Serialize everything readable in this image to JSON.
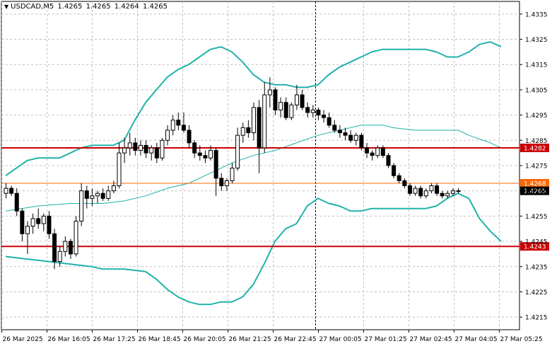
{
  "header": {
    "symbol": "USDCAD,M5",
    "open": "1.4265",
    "high": "1.4265",
    "low": "1.4264",
    "close": "1.4265"
  },
  "colors": {
    "candle": "#000000",
    "band": "#20b2aa",
    "grid": "#c0c0c0",
    "support_resistance": "#cc0000",
    "level_mid": "#ff6600",
    "current_price_bg": "#000000"
  },
  "chart_data": {
    "type": "candlestick",
    "symbol": "USDCAD",
    "timeframe": "M5",
    "ylim": [
      1.421,
      1.434
    ],
    "y_ticks": [
      "1.4335",
      "1.4325",
      "1.4315",
      "1.4305",
      "1.4295",
      "1.4285",
      "1.4275",
      "1.4265",
      "1.4255",
      "1.4245",
      "1.4235",
      "1.4225",
      "1.4215"
    ],
    "x_ticks": [
      "26 Mar 2025",
      "26 Mar 16:05",
      "26 Mar 17:25",
      "26 Mar 18:45",
      "26 Mar 20:05",
      "26 Mar 21:25",
      "26 Mar 22:45",
      "27 Mar 00:05",
      "27 Mar 01:25",
      "27 Mar 02:45",
      "27 Mar 04:05",
      "27 Mar 05:25"
    ],
    "grid": true,
    "separator_label": "27 Mar 00:05",
    "levels": [
      {
        "price": 1.4282,
        "label": "1.4282",
        "color": "#cc0000",
        "width": 2
      },
      {
        "price": 1.4268,
        "label": "1.4268",
        "color": "#ff6600",
        "width": 1
      },
      {
        "price": 1.4243,
        "label": "1.4243",
        "color": "#cc0000",
        "width": 2
      }
    ],
    "current_price": {
      "price": 1.4265,
      "label": "1.4265"
    },
    "bollinger_upper": [
      [
        0,
        1.4271
      ],
      [
        2,
        1.4274
      ],
      [
        4,
        1.4277
      ],
      [
        6,
        1.4278
      ],
      [
        8,
        1.4278
      ],
      [
        10,
        1.4278
      ],
      [
        12,
        1.428
      ],
      [
        14,
        1.4282
      ],
      [
        16,
        1.4283
      ],
      [
        18,
        1.4283
      ],
      [
        20,
        1.4283
      ],
      [
        22,
        1.4285
      ],
      [
        24,
        1.4293
      ],
      [
        26,
        1.43
      ],
      [
        28,
        1.4305
      ],
      [
        30,
        1.431
      ],
      [
        32,
        1.4313
      ],
      [
        34,
        1.4315
      ],
      [
        36,
        1.4318
      ],
      [
        38,
        1.4321
      ],
      [
        40,
        1.4322
      ],
      [
        42,
        1.432
      ],
      [
        44,
        1.4316
      ],
      [
        46,
        1.4311
      ],
      [
        48,
        1.4308
      ],
      [
        50,
        1.4307
      ],
      [
        52,
        1.4307
      ],
      [
        54,
        1.4306
      ],
      [
        56,
        1.4306
      ],
      [
        58,
        1.4307
      ],
      [
        60,
        1.4311
      ],
      [
        62,
        1.4314
      ],
      [
        64,
        1.4316
      ],
      [
        66,
        1.4318
      ],
      [
        68,
        1.432
      ],
      [
        70,
        1.4321
      ],
      [
        72,
        1.4321
      ],
      [
        74,
        1.4321
      ],
      [
        76,
        1.4321
      ],
      [
        78,
        1.4321
      ],
      [
        80,
        1.432
      ],
      [
        82,
        1.4318
      ],
      [
        84,
        1.4318
      ],
      [
        86,
        1.432
      ],
      [
        88,
        1.4323
      ],
      [
        90,
        1.4324
      ],
      [
        92,
        1.4322
      ]
    ],
    "bollinger_middle": [
      [
        0,
        1.4257
      ],
      [
        6,
        1.4259
      ],
      [
        12,
        1.426
      ],
      [
        18,
        1.426
      ],
      [
        22,
        1.4261
      ],
      [
        26,
        1.4263
      ],
      [
        30,
        1.4266
      ],
      [
        34,
        1.4268
      ],
      [
        38,
        1.4272
      ],
      [
        42,
        1.4276
      ],
      [
        46,
        1.4279
      ],
      [
        50,
        1.4281
      ],
      [
        54,
        1.4284
      ],
      [
        58,
        1.4287
      ],
      [
        62,
        1.4289
      ],
      [
        66,
        1.4291
      ],
      [
        70,
        1.4291
      ],
      [
        72,
        1.429
      ],
      [
        76,
        1.4289
      ],
      [
        80,
        1.4289
      ],
      [
        84,
        1.4289
      ],
      [
        86,
        1.4287
      ],
      [
        90,
        1.4284
      ],
      [
        92,
        1.4282
      ]
    ],
    "bollinger_lower": [
      [
        0,
        1.4239
      ],
      [
        4,
        1.4238
      ],
      [
        8,
        1.4237
      ],
      [
        12,
        1.4236
      ],
      [
        16,
        1.4235
      ],
      [
        18,
        1.4234
      ],
      [
        22,
        1.4234
      ],
      [
        26,
        1.4233
      ],
      [
        28,
        1.423
      ],
      [
        30,
        1.4226
      ],
      [
        32,
        1.4223
      ],
      [
        34,
        1.4221
      ],
      [
        36,
        1.422
      ],
      [
        38,
        1.422
      ],
      [
        40,
        1.4221
      ],
      [
        42,
        1.4221
      ],
      [
        44,
        1.4223
      ],
      [
        46,
        1.4228
      ],
      [
        48,
        1.4236
      ],
      [
        50,
        1.4245
      ],
      [
        52,
        1.425
      ],
      [
        54,
        1.4252
      ],
      [
        56,
        1.4259
      ],
      [
        58,
        1.4262
      ],
      [
        60,
        1.426
      ],
      [
        62,
        1.4259
      ],
      [
        64,
        1.4257
      ],
      [
        66,
        1.4257
      ],
      [
        68,
        1.4258
      ],
      [
        70,
        1.4258
      ],
      [
        72,
        1.4258
      ],
      [
        74,
        1.4258
      ],
      [
        76,
        1.4258
      ],
      [
        78,
        1.4258
      ],
      [
        80,
        1.4259
      ],
      [
        82,
        1.4262
      ],
      [
        84,
        1.4264
      ],
      [
        86,
        1.4262
      ],
      [
        88,
        1.4254
      ],
      [
        90,
        1.4249
      ],
      [
        92,
        1.4245
      ]
    ],
    "candles": [
      {
        "o": 1.4264,
        "h": 1.4268,
        "l": 1.4262,
        "c": 1.4266
      },
      {
        "o": 1.4266,
        "h": 1.4267,
        "l": 1.4263,
        "c": 1.4264
      },
      {
        "o": 1.4264,
        "h": 1.4266,
        "l": 1.4255,
        "c": 1.4257
      },
      {
        "o": 1.4257,
        "h": 1.4258,
        "l": 1.4245,
        "c": 1.4248
      },
      {
        "o": 1.4248,
        "h": 1.4253,
        "l": 1.424,
        "c": 1.4251
      },
      {
        "o": 1.4251,
        "h": 1.4256,
        "l": 1.4248,
        "c": 1.4254
      },
      {
        "o": 1.4254,
        "h": 1.4258,
        "l": 1.425,
        "c": 1.4252
      },
      {
        "o": 1.4252,
        "h": 1.4256,
        "l": 1.4249,
        "c": 1.4255
      },
      {
        "o": 1.4255,
        "h": 1.4257,
        "l": 1.4246,
        "c": 1.4248
      },
      {
        "o": 1.4248,
        "h": 1.425,
        "l": 1.4234,
        "c": 1.4237
      },
      {
        "o": 1.4237,
        "h": 1.4243,
        "l": 1.4235,
        "c": 1.4241
      },
      {
        "o": 1.4241,
        "h": 1.4247,
        "l": 1.4239,
        "c": 1.4245
      },
      {
        "o": 1.4245,
        "h": 1.4246,
        "l": 1.4238,
        "c": 1.424
      },
      {
        "o": 1.424,
        "h": 1.4255,
        "l": 1.4239,
        "c": 1.4253
      },
      {
        "o": 1.4253,
        "h": 1.4268,
        "l": 1.4251,
        "c": 1.4265
      },
      {
        "o": 1.4265,
        "h": 1.4267,
        "l": 1.4258,
        "c": 1.4262
      },
      {
        "o": 1.4262,
        "h": 1.4266,
        "l": 1.4259,
        "c": 1.4263
      },
      {
        "o": 1.4263,
        "h": 1.4265,
        "l": 1.426,
        "c": 1.4264
      },
      {
        "o": 1.4264,
        "h": 1.4266,
        "l": 1.4261,
        "c": 1.4262
      },
      {
        "o": 1.4262,
        "h": 1.4267,
        "l": 1.4261,
        "c": 1.4265
      },
      {
        "o": 1.4265,
        "h": 1.4269,
        "l": 1.4264,
        "c": 1.4267
      },
      {
        "o": 1.4267,
        "h": 1.4284,
        "l": 1.4266,
        "c": 1.428
      },
      {
        "o": 1.428,
        "h": 1.4286,
        "l": 1.4276,
        "c": 1.4282
      },
      {
        "o": 1.4282,
        "h": 1.4288,
        "l": 1.4279,
        "c": 1.4284
      },
      {
        "o": 1.4284,
        "h": 1.4286,
        "l": 1.4279,
        "c": 1.4281
      },
      {
        "o": 1.4281,
        "h": 1.4285,
        "l": 1.4279,
        "c": 1.4283
      },
      {
        "o": 1.4283,
        "h": 1.4285,
        "l": 1.4278,
        "c": 1.428
      },
      {
        "o": 1.428,
        "h": 1.4283,
        "l": 1.4277,
        "c": 1.4282
      },
      {
        "o": 1.4282,
        "h": 1.4284,
        "l": 1.4276,
        "c": 1.4278
      },
      {
        "o": 1.4278,
        "h": 1.4286,
        "l": 1.4277,
        "c": 1.4285
      },
      {
        "o": 1.4285,
        "h": 1.4291,
        "l": 1.4283,
        "c": 1.4289
      },
      {
        "o": 1.4289,
        "h": 1.4295,
        "l": 1.4287,
        "c": 1.4293
      },
      {
        "o": 1.4293,
        "h": 1.4296,
        "l": 1.4289,
        "c": 1.4291
      },
      {
        "o": 1.4291,
        "h": 1.4296,
        "l": 1.4288,
        "c": 1.4289
      },
      {
        "o": 1.4289,
        "h": 1.4291,
        "l": 1.4282,
        "c": 1.4284
      },
      {
        "o": 1.4284,
        "h": 1.4285,
        "l": 1.4278,
        "c": 1.428
      },
      {
        "o": 1.428,
        "h": 1.4283,
        "l": 1.4277,
        "c": 1.4279
      },
      {
        "o": 1.4279,
        "h": 1.4281,
        "l": 1.4276,
        "c": 1.4278
      },
      {
        "o": 1.4278,
        "h": 1.4283,
        "l": 1.4277,
        "c": 1.4281
      },
      {
        "o": 1.4281,
        "h": 1.4282,
        "l": 1.4263,
        "c": 1.427
      },
      {
        "o": 1.427,
        "h": 1.4272,
        "l": 1.4265,
        "c": 1.4267
      },
      {
        "o": 1.4267,
        "h": 1.427,
        "l": 1.4265,
        "c": 1.4269
      },
      {
        "o": 1.4269,
        "h": 1.4276,
        "l": 1.4268,
        "c": 1.4274
      },
      {
        "o": 1.4274,
        "h": 1.429,
        "l": 1.4273,
        "c": 1.4287
      },
      {
        "o": 1.4287,
        "h": 1.4292,
        "l": 1.4284,
        "c": 1.429
      },
      {
        "o": 1.429,
        "h": 1.4293,
        "l": 1.4286,
        "c": 1.4288
      },
      {
        "o": 1.4288,
        "h": 1.43,
        "l": 1.4285,
        "c": 1.4298
      },
      {
        "o": 1.4298,
        "h": 1.4301,
        "l": 1.4272,
        "c": 1.4282
      },
      {
        "o": 1.4282,
        "h": 1.4308,
        "l": 1.428,
        "c": 1.4303
      },
      {
        "o": 1.4303,
        "h": 1.431,
        "l": 1.4298,
        "c": 1.4305
      },
      {
        "o": 1.4305,
        "h": 1.4306,
        "l": 1.4295,
        "c": 1.4297
      },
      {
        "o": 1.4297,
        "h": 1.4302,
        "l": 1.4294,
        "c": 1.43
      },
      {
        "o": 1.43,
        "h": 1.4302,
        "l": 1.4293,
        "c": 1.4294
      },
      {
        "o": 1.4294,
        "h": 1.43,
        "l": 1.4293,
        "c": 1.4299
      },
      {
        "o": 1.4299,
        "h": 1.4307,
        "l": 1.4297,
        "c": 1.4303
      },
      {
        "o": 1.4303,
        "h": 1.4305,
        "l": 1.4297,
        "c": 1.4298
      },
      {
        "o": 1.4298,
        "h": 1.43,
        "l": 1.4294,
        "c": 1.4296
      },
      {
        "o": 1.4296,
        "h": 1.4299,
        "l": 1.4294,
        "c": 1.4297
      },
      {
        "o": 1.4297,
        "h": 1.4298,
        "l": 1.4293,
        "c": 1.4295
      },
      {
        "o": 1.4295,
        "h": 1.4297,
        "l": 1.4292,
        "c": 1.4294
      },
      {
        "o": 1.4294,
        "h": 1.4296,
        "l": 1.429,
        "c": 1.4291
      },
      {
        "o": 1.4291,
        "h": 1.4293,
        "l": 1.4288,
        "c": 1.4289
      },
      {
        "o": 1.4289,
        "h": 1.4291,
        "l": 1.4286,
        "c": 1.4288
      },
      {
        "o": 1.4288,
        "h": 1.429,
        "l": 1.4285,
        "c": 1.4287
      },
      {
        "o": 1.4287,
        "h": 1.4289,
        "l": 1.4284,
        "c": 1.4285
      },
      {
        "o": 1.4285,
        "h": 1.4288,
        "l": 1.4283,
        "c": 1.4287
      },
      {
        "o": 1.4287,
        "h": 1.4288,
        "l": 1.4281,
        "c": 1.4282
      },
      {
        "o": 1.4282,
        "h": 1.4284,
        "l": 1.4278,
        "c": 1.428
      },
      {
        "o": 1.428,
        "h": 1.4281,
        "l": 1.4277,
        "c": 1.4279
      },
      {
        "o": 1.4279,
        "h": 1.4283,
        "l": 1.4278,
        "c": 1.4282
      },
      {
        "o": 1.4282,
        "h": 1.4283,
        "l": 1.4278,
        "c": 1.4279
      },
      {
        "o": 1.4279,
        "h": 1.428,
        "l": 1.4274,
        "c": 1.4275
      },
      {
        "o": 1.4275,
        "h": 1.4276,
        "l": 1.427,
        "c": 1.4271
      },
      {
        "o": 1.4271,
        "h": 1.4272,
        "l": 1.4268,
        "c": 1.4269
      },
      {
        "o": 1.4269,
        "h": 1.427,
        "l": 1.4266,
        "c": 1.4267
      },
      {
        "o": 1.4267,
        "h": 1.4268,
        "l": 1.4263,
        "c": 1.4264
      },
      {
        "o": 1.4264,
        "h": 1.4267,
        "l": 1.4263,
        "c": 1.4266
      },
      {
        "o": 1.4266,
        "h": 1.4267,
        "l": 1.4262,
        "c": 1.4263
      },
      {
        "o": 1.4263,
        "h": 1.4266,
        "l": 1.4262,
        "c": 1.4265
      },
      {
        "o": 1.4265,
        "h": 1.4268,
        "l": 1.4264,
        "c": 1.4267
      },
      {
        "o": 1.4267,
        "h": 1.4268,
        "l": 1.4263,
        "c": 1.4264
      },
      {
        "o": 1.4264,
        "h": 1.4265,
        "l": 1.4262,
        "c": 1.4263
      },
      {
        "o": 1.4263,
        "h": 1.4265,
        "l": 1.4262,
        "c": 1.4264
      },
      {
        "o": 1.4264,
        "h": 1.4266,
        "l": 1.4263,
        "c": 1.4265
      },
      {
        "o": 1.4265,
        "h": 1.4266,
        "l": 1.4264,
        "c": 1.4265
      }
    ]
  }
}
